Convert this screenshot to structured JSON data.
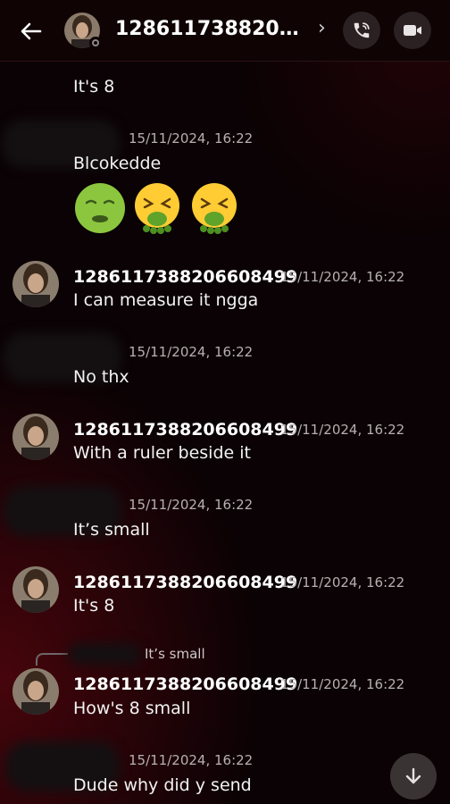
{
  "header": {
    "title": "12861173882066...",
    "back_icon": "arrow-left-icon",
    "call_icon": "phone-call-icon",
    "video_icon": "video-camera-icon",
    "chevron_icon": "chevron-right-icon"
  },
  "messages": [
    {
      "author": "",
      "timestamp": "",
      "text": "It's 8"
    },
    {
      "author": "",
      "timestamp": "15/11/2024, 16:22",
      "text": "Blcokedde",
      "emojis": [
        "nauseated-face-icon",
        "vomiting-face-icon",
        "vomiting-face-icon"
      ]
    },
    {
      "author": "1286117388206608499",
      "timestamp": "15/11/2024, 16:22",
      "text": "I can measure it ngga"
    },
    {
      "author": "",
      "timestamp": "15/11/2024, 16:22",
      "text": "No thx"
    },
    {
      "author": "1286117388206608499",
      "timestamp": "15/11/2024, 16:22",
      "text": "With a ruler beside it"
    },
    {
      "author": "",
      "timestamp": "15/11/2024, 16:22",
      "text": "It’s small"
    },
    {
      "author": "1286117388206608499",
      "timestamp": "15/11/2024, 16:22",
      "text": "It's 8"
    },
    {
      "author": "1286117388206608499",
      "timestamp": "15/11/2024, 16:22",
      "text": "How's 8 small",
      "reply_to": "It’s small"
    },
    {
      "author": "",
      "timestamp": "15/11/2024, 16:22",
      "text": "Dude why did y send"
    }
  ],
  "scroll_icon": "arrow-down-icon",
  "colors": {
    "background": "#0a0204",
    "accent_red": "#780812",
    "button_bg": "#2b2123"
  }
}
